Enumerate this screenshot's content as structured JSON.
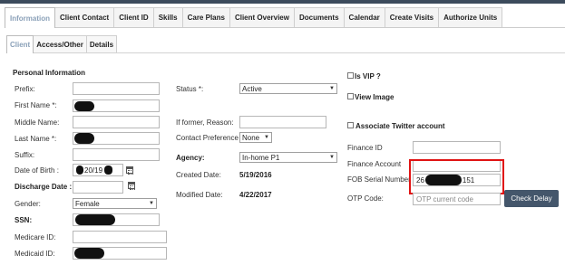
{
  "primary_tabs": [
    {
      "label": "Information",
      "active": true
    },
    {
      "label": "Client Contact",
      "active": false
    },
    {
      "label": "Client ID",
      "active": false
    },
    {
      "label": "Skills",
      "active": false
    },
    {
      "label": "Care Plans",
      "active": false
    },
    {
      "label": "Client Overview",
      "active": false
    },
    {
      "label": "Documents",
      "active": false
    },
    {
      "label": "Calendar",
      "active": false
    },
    {
      "label": "Create Visits",
      "active": false
    },
    {
      "label": "Authorize Units",
      "active": false
    }
  ],
  "secondary_tabs": [
    {
      "label": "Client",
      "active": true
    },
    {
      "label": "Access/Other",
      "active": false
    },
    {
      "label": "Details",
      "active": false
    }
  ],
  "personal_information": {
    "title": "Personal Information",
    "prefix_label": "Prefix:",
    "first_name_label": "First Name *:",
    "middle_name_label": "Middle Name:",
    "last_name_label": "Last Name *:",
    "suffix_label": "Suffix:",
    "dob_label": "Date of Birth :",
    "dob_value": "20/19",
    "discharge_label": "Discharge Date :",
    "gender_label": "Gender:",
    "gender_value": "Female",
    "ssn_label": "SSN:",
    "medicare_label": "Medicare ID:",
    "medicaid_label": "Medicaid ID:"
  },
  "status_section": {
    "status_label": "Status *:",
    "status_value": "Active",
    "former_reason_label": "If former, Reason:",
    "contact_pref_label": "Contact Preference",
    "contact_pref_value": "None",
    "agency_label": "Agency:",
    "agency_value": "In-home P1",
    "created_label": "Created Date:",
    "created_value": "5/19/2016",
    "modified_label": "Modified Date:",
    "modified_value": "4/22/2017"
  },
  "right_panel": {
    "is_vip_label": "Is VIP ?",
    "view_image_label": "View Image",
    "twitter_label": "Associate Twitter account",
    "finance_id_label": "Finance ID",
    "finance_account_label": "Finance Account",
    "fob_serial_label": "FOB Serial Number",
    "fob_serial_prefix": "26",
    "fob_serial_suffix": "151",
    "otp_label": "OTP Code:",
    "otp_placeholder": "OTP current code",
    "check_delay_label": "Check Delay"
  },
  "colors": {
    "top_bar": "#3c4b5c",
    "active_tab_text": "#8aa0b8",
    "button_bg": "#44566b",
    "highlight_border": "#e01313"
  }
}
